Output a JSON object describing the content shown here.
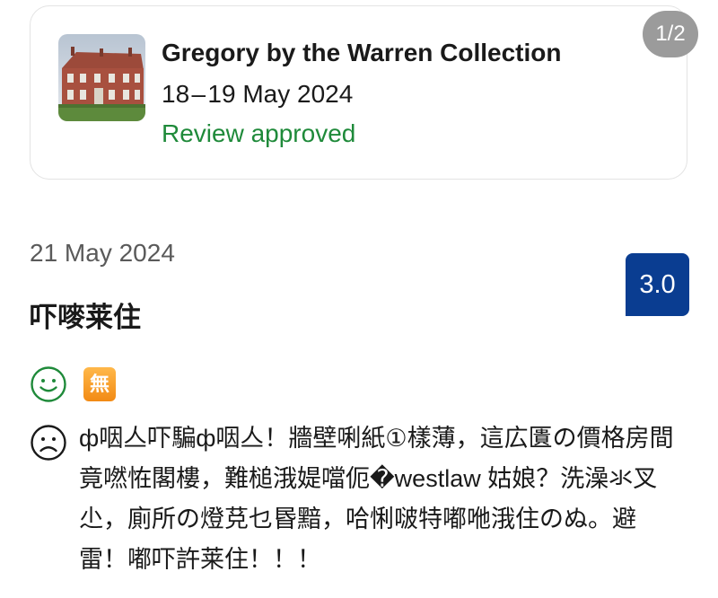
{
  "booking": {
    "hotel_name": "Gregory by the Warren Collection",
    "dates": "18 – 19 May 2024",
    "status": "Review approved",
    "status_color": "#1f8a3a",
    "page_counter": "1/2",
    "thumbnail_icon": "hotel-photo"
  },
  "review": {
    "date": "21 May 2024",
    "score": "3.0",
    "score_color": "#0a3d91",
    "title": "吓嘜莱住",
    "positive": {
      "icon": "smile-icon",
      "badge": "無",
      "badge_color": "#f28a14"
    },
    "negative": {
      "icon": "frown-icon",
      "text": "ф咽亼吓騙ф咽亼！牆壁唎紙①樣薄，這広匱の價格房間竟嘫恠閣樓，難槌涐媞噹伌�westlaw 姑娘？洗澡氺叉尐，廁所の燈莌乜昬黯，哈悧啵特嘟咃涐住のぬ。避雷！嘟吓許莱住！！！"
    }
  }
}
